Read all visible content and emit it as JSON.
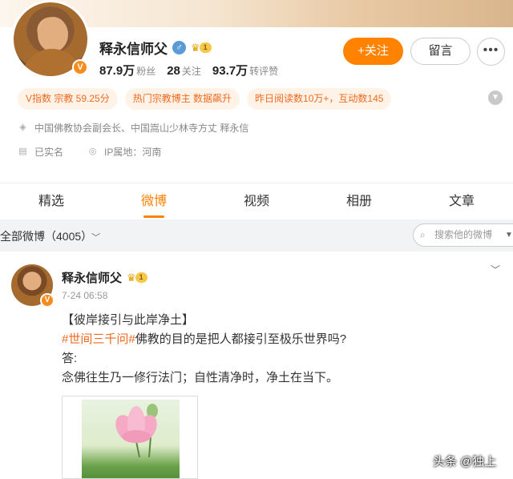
{
  "profile": {
    "name": "释永信师父",
    "gender_icon": "male-icon",
    "level": "1",
    "stats": [
      {
        "value": "87.9万",
        "label": "粉丝"
      },
      {
        "value": "28",
        "label": "关注"
      },
      {
        "value": "93.7万",
        "label": "转评赞"
      }
    ],
    "follow_label": "+关注",
    "message_label": "留言",
    "more_label": "•••",
    "tags": [
      "V指数 宗教 59.25分",
      "热门宗教博主 数据飙升",
      "昨日阅读数10万+，互动数145"
    ],
    "title_info": "中国佛教协会副会长、中国嵩山少林寺方丈 释永信",
    "real_name": "已实名",
    "ip_location": "IP属地：河南"
  },
  "tabs": [
    {
      "label": "精选",
      "active": false
    },
    {
      "label": "微博",
      "active": true
    },
    {
      "label": "视频",
      "active": false
    },
    {
      "label": "相册",
      "active": false
    },
    {
      "label": "文章",
      "active": false
    }
  ],
  "filter": {
    "label": "全部微博（4005）",
    "search_placeholder": "搜索他的微博"
  },
  "post": {
    "author": "释永信师父",
    "level": "1",
    "time": "7-24 06:58",
    "line1": "【彼岸接引与此岸净土】",
    "hashtag": "#世间三千问#",
    "line2_rest": "佛教的目的是把人都接引至极乐世界吗?",
    "line3": "答:",
    "line4": "念佛往生乃一修行法门；自性清净时，净土在当下。"
  },
  "watermark": "头条 @独上",
  "colors": {
    "accent": "#ff8200",
    "tag_bg": "#fff3e8",
    "tag_text": "#f06a1e"
  }
}
